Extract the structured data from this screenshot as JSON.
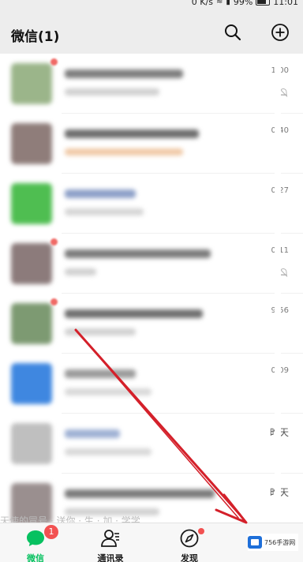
{
  "status_bar": {
    "network_speed": "0 K/s",
    "battery_percent": "99%",
    "time": "11:01"
  },
  "header": {
    "title": "微信(1)",
    "search_icon": "search-icon",
    "add_icon": "plus-circle-icon"
  },
  "chats": [
    {
      "time": "1:00",
      "muted": true,
      "avatar_color": "#9bb58a",
      "name_color": "#7d7d7d",
      "preview_color": "#d0d0d0"
    },
    {
      "time": "0:40",
      "muted": false,
      "avatar_color": "#8f7d7a",
      "name_color": "#6d6d6d",
      "preview_color": "#f0c9a6"
    },
    {
      "time": "0:27",
      "muted": false,
      "avatar_color": "#4fbe51",
      "name_color": "#8da0c8",
      "preview_color": "#d5d5d5"
    },
    {
      "time": "0:11",
      "muted": true,
      "avatar_color": "#8c7b7b",
      "name_color": "#7b7b7b",
      "preview_color": "#d0d0d0"
    },
    {
      "time": "9:56",
      "muted": false,
      "avatar_color": "#7d9a72",
      "name_color": "#6f6f6f",
      "preview_color": "#d0d0d0"
    },
    {
      "time": "0:09",
      "muted": false,
      "avatar_color": "#3f87e0",
      "name_color": "#9a9a9a",
      "preview_color": "#d8d8d8"
    },
    {
      "time": "昨天",
      "muted": false,
      "avatar_color": "#bfbfbf",
      "name_color": "#9fb1d4",
      "preview_color": "#d8d8d8"
    },
    {
      "time": "昨天",
      "muted": false,
      "avatar_color": "#9a8f8f",
      "name_color": "#7a7a7a",
      "preview_color": "#d0d0d0"
    }
  ],
  "preview_strip_text": "天使的冒号 · 送你 · 生 · 加 · 学学",
  "tabs": [
    {
      "label": "微信",
      "icon": "chat-bubble-icon",
      "badge": "1",
      "active": true
    },
    {
      "label": "通讯录",
      "icon": "contacts-icon",
      "active": false
    },
    {
      "label": "发现",
      "icon": "compass-icon",
      "dot": true,
      "active": false
    }
  ],
  "watermark": {
    "text": "756手游网",
    "logo_color": "#1e6fd9"
  },
  "annotation": {
    "arrow_color": "#d4202a"
  }
}
